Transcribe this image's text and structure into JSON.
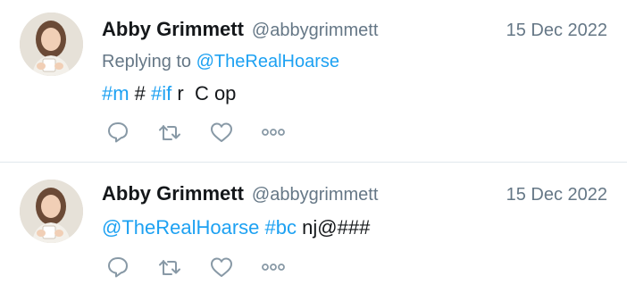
{
  "tweets": [
    {
      "author_name": "Abby Grimmett",
      "handle": "@abbygrimmett",
      "date": "15 Dec 2022",
      "replying_prefix": "Replying to",
      "replying_to": "@TheRealHoarse",
      "text_segments": [
        "#m",
        " # ",
        "#if",
        " r  C op"
      ]
    },
    {
      "author_name": "Abby Grimmett",
      "handle": "@abbygrimmett",
      "date": "15 Dec 2022",
      "text_segments": [
        "@TheRealHoarse",
        " ",
        "#bc",
        " nj@###"
      ]
    }
  ],
  "colors": {
    "link": "#1da1f2",
    "secondary_text": "#657786",
    "primary_text": "#14171a",
    "icon": "#8899a6",
    "divider": "#e1e8ed"
  },
  "icons": {
    "reply": "reply-icon",
    "retweet": "retweet-icon",
    "like": "like-icon",
    "more": "more-icon"
  }
}
